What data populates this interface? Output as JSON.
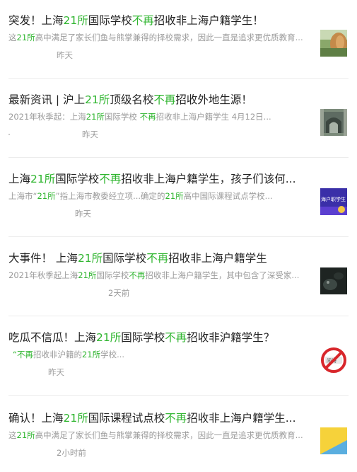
{
  "articles": [
    {
      "title": [
        "突发！上海",
        "21所",
        "国际学校",
        "不再",
        "招收非上海户籍学生！"
      ],
      "desc": [
        "这",
        "21所",
        "高中满足了家长们鱼与熊掌兼得的择校需求，因此一直是追求更优质教育..."
      ],
      "time": "昨天",
      "thumb_icon": "landscape-photo"
    },
    {
      "title": [
        "最新资讯 | 沪上",
        "21所",
        "顶级名校",
        "不再",
        "招收外地生源！"
      ],
      "desc": [
        "2021年秋季起：上海",
        "21所",
        "国际学校 ",
        "不再",
        "招收非上海户籍学生 4月12日..."
      ],
      "time": "昨天",
      "thumb_icon": "campus-photo"
    },
    {
      "title": [
        "上海",
        "21所",
        "国际学校",
        "不再",
        "招收非上海户籍学生，孩子们该何..."
      ],
      "desc": [
        "上海市“",
        "21所",
        "”指上海市教委经立项...确定的",
        "21所",
        "高中国际课程试点学校..."
      ],
      "time": "昨天",
      "thumb_icon": "banner-graphic"
    },
    {
      "title": [
        "大事件！ 上海",
        "21所",
        "国际学校",
        "不再",
        "招收非上海户籍学生"
      ],
      "desc": [
        "2021年秋季起上海",
        "21所",
        "国际学校",
        "不再",
        "招收非上海户籍学生，其中包含了深受家..."
      ],
      "time": "2天前",
      "thumb_icon": "dark-photo"
    },
    {
      "title": [
        "吃瓜不信瓜！上海",
        "21所",
        "国际学校",
        "不再",
        "招收非沪籍学生？"
      ],
      "desc": [
        "“",
        "不再",
        "招收非沪籍的",
        "21所",
        "学校..."
      ],
      "time": "昨天",
      "thumb_icon": "no-entry-sign"
    },
    {
      "title": [
        "确认！上海",
        "21所",
        "国际课程试点校",
        "不再",
        "招收非上海户籍学生..."
      ],
      "desc": [
        "这",
        "21所",
        "高中满足了家长们鱼与熊掌兼得的择校需求，因此一直是追求更优质教育..."
      ],
      "time": "2小时前",
      "thumb_icon": "yellow-blue-graphic"
    }
  ],
  "thumb_badges": {
    "banner": "海户职学生",
    "sign": "闹海"
  },
  "colors": {
    "highlight": "#2fb52f",
    "title": "#222222",
    "meta": "#9a9a9a",
    "divider": "#ececec"
  }
}
